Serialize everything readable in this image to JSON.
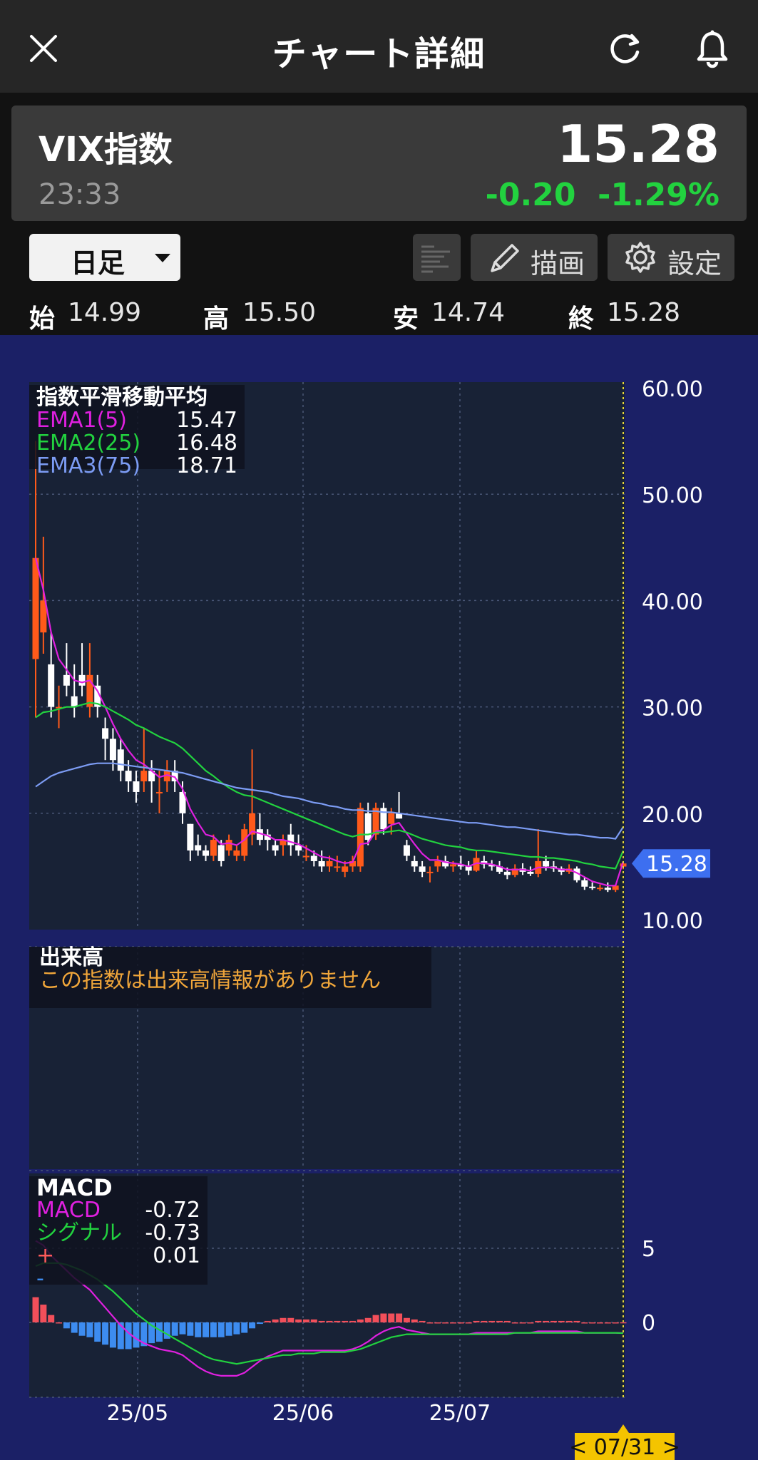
{
  "header": {
    "title": "チャート詳細",
    "close_icon": "close-icon",
    "reload_icon": "reload-icon",
    "bell_icon": "bell-icon"
  },
  "quote": {
    "name": "VIX指数",
    "time": "23:33",
    "price": "15.28",
    "change": "-0.20",
    "change_pct": "-1.29%",
    "change_color": "#22d23f"
  },
  "controls": {
    "period": "日足",
    "board_icon": "board-icon",
    "draw_label": "描画",
    "draw_icon": "pencil-icon",
    "settings_label": "設定",
    "settings_icon": "gear-icon"
  },
  "ohlc": {
    "open_label": "始",
    "open": "14.99",
    "high_label": "高",
    "high": "15.50",
    "low_label": "安",
    "low": "14.74",
    "close_label": "終",
    "close": "15.28"
  },
  "ema_legend": {
    "title": "指数平滑移動平均",
    "items": [
      {
        "name": "EMA1(5)",
        "value": "15.47",
        "color": "#e020e0"
      },
      {
        "name": "EMA2(25)",
        "value": "16.48",
        "color": "#22d23f"
      },
      {
        "name": "EMA3(75)",
        "value": "18.71",
        "color": "#7c9cf4"
      }
    ]
  },
  "volume_legend": {
    "title": "出来高",
    "message": "この指数は出来高情報がありません"
  },
  "macd_legend": {
    "title": "MACD",
    "items": [
      {
        "name": "MACD",
        "value": "-0.72",
        "color": "#e020e0"
      },
      {
        "name": "シグナル",
        "value": "-0.73",
        "color": "#22d23f"
      },
      {
        "name": "+",
        "value": "0.01",
        "color": "#ff5a5a"
      },
      {
        "name": "-",
        "value": "",
        "color": "#3d8cf0"
      }
    ]
  },
  "chart_data": {
    "type": "candlestick",
    "price_axis": [
      "60.00",
      "50.00",
      "40.00",
      "30.00",
      "20.00",
      "10.00"
    ],
    "ylim": [
      10,
      60
    ],
    "date_labels": [
      "25/05",
      "25/06",
      "25/07"
    ],
    "current_price_label": "15.28",
    "cursor_date": "< 07/31 >",
    "macd_axis": [
      "5",
      "0"
    ],
    "candles": [
      [
        34.5,
        55,
        29,
        44
      ],
      [
        37,
        46,
        35,
        40
      ],
      [
        34,
        37,
        29,
        30
      ],
      [
        30,
        32,
        28,
        30
      ],
      [
        33,
        36,
        31,
        32
      ],
      [
        31,
        34,
        29,
        30
      ],
      [
        33,
        36,
        31,
        32
      ],
      [
        30,
        36,
        29,
        33
      ],
      [
        32,
        33,
        29,
        30
      ],
      [
        28,
        29,
        25,
        27
      ],
      [
        27,
        28,
        24,
        25
      ],
      [
        26,
        27,
        23,
        24
      ],
      [
        24,
        25,
        22,
        23
      ],
      [
        23,
        24,
        21,
        22
      ],
      [
        23,
        28,
        22,
        24
      ],
      [
        24,
        25,
        21,
        23
      ],
      [
        22,
        24,
        20,
        22
      ],
      [
        23,
        25,
        22,
        24
      ],
      [
        24,
        25,
        22,
        23
      ],
      [
        22,
        23,
        19,
        20
      ],
      [
        19,
        19,
        15.5,
        16.5
      ],
      [
        17,
        18,
        16,
        16.5
      ],
      [
        16.5,
        17,
        15.5,
        16
      ],
      [
        16,
        18,
        15.5,
        17.5
      ],
      [
        17,
        17.5,
        15,
        15.5
      ],
      [
        16.5,
        18,
        16,
        17.5
      ],
      [
        16,
        17,
        15.5,
        16.5
      ],
      [
        16,
        19,
        15.5,
        18.5
      ],
      [
        18,
        26,
        17,
        20
      ],
      [
        18.5,
        20,
        17,
        17.5
      ],
      [
        18,
        18.5,
        16.5,
        17.5
      ],
      [
        17,
        17.5,
        16,
        16.5
      ],
      [
        17,
        18,
        16,
        17.5
      ],
      [
        18,
        19,
        16,
        17
      ],
      [
        17,
        18,
        16,
        16.5
      ],
      [
        16,
        17,
        15.5,
        16
      ],
      [
        16,
        16.5,
        15,
        15.5
      ],
      [
        15.5,
        16.5,
        14.5,
        15
      ],
      [
        15,
        16,
        14.5,
        15.5
      ],
      [
        15,
        16,
        14.5,
        15
      ],
      [
        14.5,
        15.5,
        14,
        15
      ],
      [
        15,
        16,
        14.5,
        15.5
      ],
      [
        15,
        21,
        14.5,
        20.5
      ],
      [
        20,
        21,
        17,
        17.5
      ],
      [
        18,
        21,
        17.5,
        20.5
      ],
      [
        20.5,
        21,
        18,
        18.5
      ],
      [
        19,
        20.5,
        18,
        20
      ],
      [
        20,
        22,
        19.5,
        19.5
      ],
      [
        17,
        17.5,
        15.5,
        16
      ],
      [
        15.5,
        16,
        14.5,
        15
      ],
      [
        15,
        15.5,
        14,
        14.5
      ],
      [
        14.5,
        15,
        13.5,
        14.5
      ],
      [
        15,
        16,
        14.5,
        15.5
      ],
      [
        15.5,
        16,
        14.8,
        15
      ],
      [
        15,
        15.5,
        14.5,
        15.2
      ],
      [
        15.2,
        16,
        14.7,
        15
      ],
      [
        15,
        15.5,
        14.2,
        14.6
      ],
      [
        14.6,
        16.5,
        14.5,
        15.8
      ],
      [
        15.5,
        16,
        14.8,
        15.2
      ],
      [
        15.2,
        15.6,
        14.6,
        15
      ],
      [
        15,
        15.5,
        14.3,
        14.5
      ],
      [
        14.5,
        14.9,
        13.8,
        14.2
      ],
      [
        14.2,
        15.2,
        14,
        14.8
      ],
      [
        14.8,
        15.3,
        14.2,
        14.5
      ],
      [
        14.5,
        15,
        14.1,
        14.3
      ],
      [
        14.3,
        18.5,
        14,
        15.5
      ],
      [
        15.5,
        16,
        14.6,
        15
      ],
      [
        15,
        15.5,
        14.5,
        14.8
      ],
      [
        14.8,
        15,
        14.2,
        14.5
      ],
      [
        14.5,
        15.2,
        14.3,
        14.8
      ],
      [
        14.8,
        15,
        13.5,
        13.7
      ],
      [
        13.7,
        14,
        12.8,
        13.1
      ],
      [
        13.1,
        13.5,
        12.8,
        13
      ],
      [
        13,
        13.3,
        12.7,
        13
      ],
      [
        13,
        13.5,
        12.6,
        12.8
      ],
      [
        12.8,
        13.3,
        12.6,
        13.2
      ],
      [
        14.99,
        15.5,
        14.74,
        15.28
      ]
    ],
    "ema_series": {
      "EMA1(5)": [
        44,
        41,
        37,
        34.5,
        33.5,
        32.5,
        32.3,
        32.5,
        31.5,
        30,
        28.4,
        27,
        25.9,
        25,
        24.6,
        24,
        23.4,
        23.6,
        23.4,
        22.3,
        20.4,
        19.1,
        18,
        17.8,
        17.1,
        17.2,
        17,
        17.5,
        18.3,
        18.1,
        17.9,
        17.5,
        17.5,
        17.3,
        17.1,
        16.7,
        16.3,
        15.9,
        15.8,
        15.5,
        15.3,
        15.4,
        17.1,
        17.2,
        18.3,
        18.4,
        18.9,
        19.1,
        18.1,
        17.1,
        16.2,
        15.6,
        15.6,
        15.4,
        15.3,
        15.2,
        15,
        15.3,
        15.3,
        15.2,
        15,
        14.7,
        14.7,
        14.7,
        14.6,
        14.9,
        14.9,
        14.9,
        14.7,
        14.7,
        14.4,
        14,
        13.6,
        13.4,
        13.2,
        13.2,
        15.47
      ],
      "EMA2(25)": [
        29,
        29.5,
        29.6,
        29.8,
        30,
        30,
        30.2,
        30.4,
        30.3,
        30,
        29.6,
        29.2,
        28.8,
        28.3,
        28,
        27.6,
        27.2,
        26.9,
        26.6,
        26.1,
        25.4,
        24.7,
        24,
        23.5,
        22.9,
        22.4,
        22,
        21.7,
        21.6,
        21.3,
        21,
        20.7,
        20.4,
        20.1,
        19.8,
        19.5,
        19.2,
        18.9,
        18.6,
        18.3,
        18,
        17.8,
        18,
        18,
        18.2,
        18.2,
        18.3,
        18.4,
        18.2,
        17.9,
        17.6,
        17.4,
        17.2,
        17,
        16.9,
        16.8,
        16.6,
        16.5,
        16.5,
        16.4,
        16.3,
        16.2,
        16.1,
        16,
        15.9,
        15.9,
        15.8,
        15.8,
        15.7,
        15.6,
        15.5,
        15.3,
        15.2,
        15,
        14.9,
        14.8,
        16.48
      ],
      "EMA3(75)": [
        22.5,
        23,
        23.5,
        23.8,
        24,
        24.2,
        24.4,
        24.6,
        24.7,
        24.7,
        24.7,
        24.6,
        24.5,
        24.4,
        24.3,
        24.2,
        24.1,
        24,
        23.9,
        23.8,
        23.6,
        23.4,
        23.2,
        23,
        22.8,
        22.6,
        22.4,
        22.3,
        22.2,
        22.1,
        22,
        21.8,
        21.6,
        21.5,
        21.4,
        21.2,
        21,
        20.9,
        20.7,
        20.6,
        20.4,
        20.3,
        20.3,
        20.2,
        20.2,
        20.1,
        20.1,
        20,
        19.9,
        19.8,
        19.7,
        19.6,
        19.5,
        19.4,
        19.3,
        19.2,
        19.1,
        19.1,
        19,
        18.9,
        18.8,
        18.7,
        18.7,
        18.6,
        18.5,
        18.4,
        18.3,
        18.2,
        18.1,
        18,
        18,
        17.9,
        17.8,
        17.7,
        17.7,
        17.6,
        18.71
      ]
    },
    "macd_series": {
      "MACD": [
        5.5,
        5.2,
        4.5,
        4,
        3.5,
        3,
        2.6,
        2.2,
        1.6,
        1,
        0.4,
        -0.2,
        -0.7,
        -1.1,
        -1.4,
        -1.6,
        -1.8,
        -1.9,
        -2,
        -2.2,
        -2.6,
        -3,
        -3.3,
        -3.5,
        -3.6,
        -3.6,
        -3.6,
        -3.4,
        -3,
        -2.6,
        -2.3,
        -2.1,
        -1.9,
        -1.9,
        -1.9,
        -1.9,
        -1.9,
        -1.9,
        -1.9,
        -1.9,
        -1.9,
        -1.8,
        -1.6,
        -1.3,
        -0.9,
        -0.6,
        -0.4,
        -0.3,
        -0.5,
        -0.6,
        -0.7,
        -0.8,
        -0.8,
        -0.8,
        -0.8,
        -0.8,
        -0.8,
        -0.7,
        -0.7,
        -0.7,
        -0.7,
        -0.7,
        -0.7,
        -0.7,
        -0.7,
        -0.6,
        -0.6,
        -0.6,
        -0.6,
        -0.6,
        -0.6,
        -0.7,
        -0.7,
        -0.7,
        -0.7,
        -0.7,
        -0.72
      ],
      "シグナル": [
        3.8,
        4,
        4,
        4,
        3.9,
        3.7,
        3.5,
        3.2,
        2.9,
        2.5,
        2.1,
        1.6,
        1.1,
        0.6,
        0.2,
        -0.2,
        -0.5,
        -0.8,
        -1.1,
        -1.4,
        -1.7,
        -2,
        -2.3,
        -2.5,
        -2.6,
        -2.7,
        -2.8,
        -2.7,
        -2.6,
        -2.5,
        -2.4,
        -2.3,
        -2.2,
        -2.2,
        -2.1,
        -2.1,
        -2.1,
        -2,
        -2,
        -2,
        -2,
        -1.9,
        -1.8,
        -1.6,
        -1.4,
        -1.2,
        -1,
        -0.9,
        -0.8,
        -0.8,
        -0.8,
        -0.8,
        -0.8,
        -0.8,
        -0.8,
        -0.8,
        -0.8,
        -0.8,
        -0.8,
        -0.8,
        -0.8,
        -0.8,
        -0.7,
        -0.7,
        -0.7,
        -0.7,
        -0.7,
        -0.7,
        -0.7,
        -0.7,
        -0.7,
        -0.7,
        -0.7,
        -0.7,
        -0.7,
        -0.7,
        -0.73
      ],
      "histogram": [
        1.7,
        1.2,
        0.5,
        0,
        -0.4,
        -0.7,
        -0.9,
        -1,
        -1.3,
        -1.5,
        -1.7,
        -1.8,
        -1.8,
        -1.7,
        -1.6,
        -1.4,
        -1.3,
        -1.1,
        -0.9,
        -0.8,
        -0.9,
        -1,
        -1,
        -1,
        -1,
        -0.9,
        -0.8,
        -0.7,
        -0.4,
        -0.1,
        0.1,
        0.2,
        0.3,
        0.3,
        0.2,
        0.2,
        0.2,
        0.1,
        0.1,
        0.1,
        0.1,
        0.1,
        0.2,
        0.3,
        0.5,
        0.6,
        0.6,
        0.6,
        0.3,
        0.2,
        0.1,
        0,
        0,
        0,
        0,
        0,
        0,
        0.1,
        0.1,
        0.1,
        0.1,
        0.1,
        0,
        0,
        0,
        0.1,
        0.1,
        0.1,
        0.1,
        0.1,
        0.1,
        0,
        0,
        0,
        0,
        0,
        0.01
      ]
    }
  }
}
